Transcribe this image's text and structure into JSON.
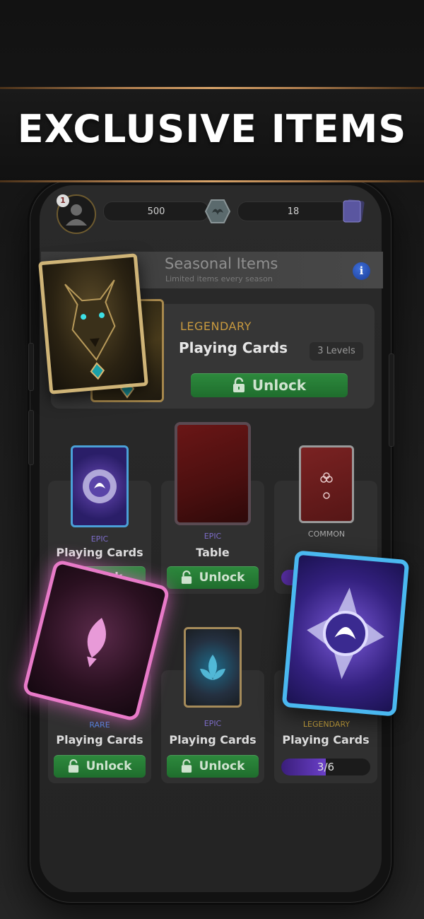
{
  "banner": {
    "title": "EXCLUSIVE ITEMS"
  },
  "status": {
    "avatar_badge": "1",
    "coins": "500",
    "cards": "18"
  },
  "seasonal": {
    "title": "Seasonal Items",
    "subtitle": "Limited items every season",
    "info_icon": "i"
  },
  "featured": {
    "rarity": "LEGENDARY",
    "name": "Playing Cards",
    "levels": "3 Levels",
    "button": "Unlock"
  },
  "items": [
    {
      "rarity": "EPIC",
      "name": "Playing Cards",
      "button": "Unlock",
      "rarity_color": "#7c6cc7"
    },
    {
      "rarity": "EPIC",
      "name": "Table",
      "button": "Unlock",
      "rarity_color": "#7c6cc7"
    },
    {
      "rarity": "COMMON",
      "name": "",
      "button": "",
      "rarity_color": "#a8a8a8"
    },
    {
      "rarity": "RARE",
      "name": "Playing Cards",
      "button": "Unlock",
      "rarity_color": "#4e7fd6"
    },
    {
      "rarity": "EPIC",
      "name": "Playing Cards",
      "button": "Unlock",
      "rarity_color": "#7c6cc7"
    },
    {
      "rarity": "LEGENDARY",
      "name": "Playing Cards",
      "progress": "3/6",
      "progress_fraction": 0.5,
      "rarity_color": "#c9a43f"
    }
  ],
  "colors": {
    "accent_green": "#2d8a3d",
    "gold_trim": "#d8a46a",
    "progress_purple": "#5a2fa8"
  }
}
